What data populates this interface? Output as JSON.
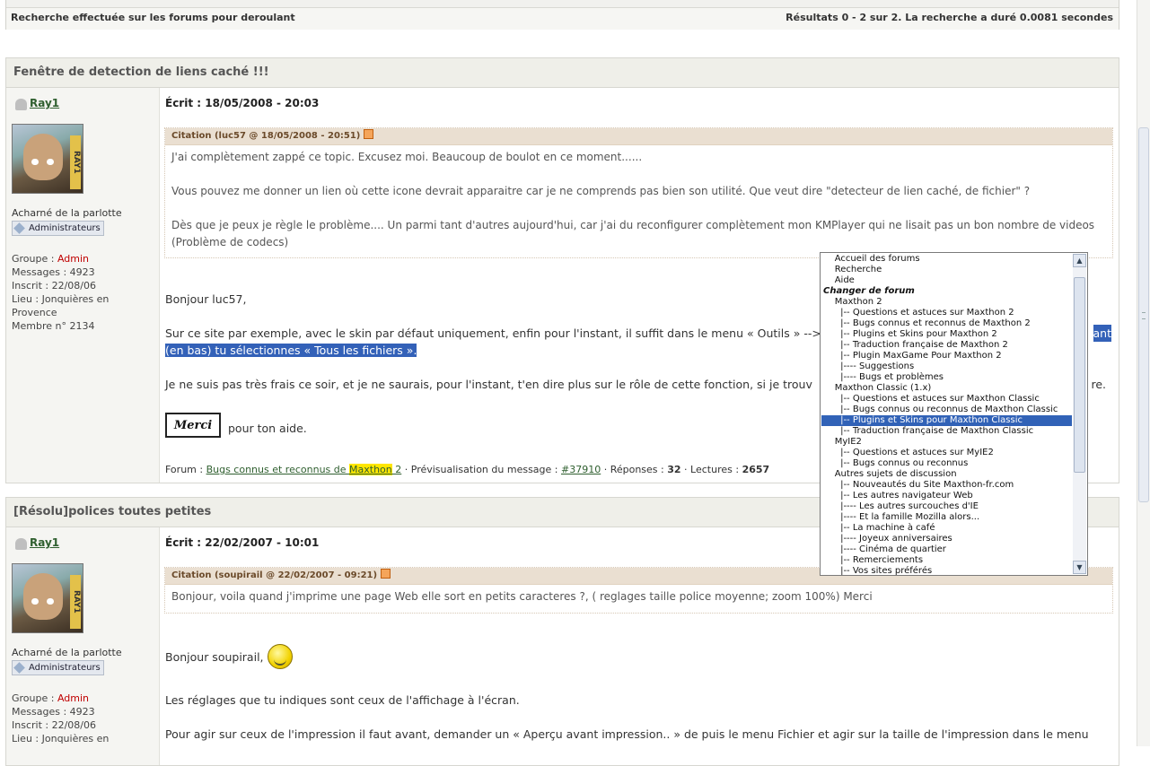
{
  "search_bar": {
    "left": "Recherche effectuée sur les forums pour deroulant",
    "right": "Résultats 0 - 2 sur 2. La recherche a duré 0.0081 secondes"
  },
  "posts": [
    {
      "title": "Fenêtre de detection de liens caché !!!",
      "user": "Ray1",
      "avatar_tag": "RAY1",
      "rank": "Acharné de la parlotte",
      "badge": "Administrateurs",
      "groupe_label": "Groupe : ",
      "groupe_value": "Admin",
      "messages": "Messages : 4923",
      "inscrit": "Inscrit : 22/08/06",
      "lieu": "Lieu : Jonquières en Provence",
      "membre": "Membre n° 2134",
      "written": "Écrit : 18/05/2008 - 20:03",
      "quote_head": "Citation (luc57 @ 18/05/2008 - 20:51)",
      "quote_lines": [
        "J'ai complètement zappé ce topic. Excusez moi. Beaucoup de boulot en ce moment......",
        "Vous pouvez me donner un lien où cette icone devrait apparaitre car je ne comprends pas bien son utilité. Que veut dire \"detecteur de lien caché, de fichier\" ?",
        "Dès que je peux je règle le problème.... Un parmi tant d'autres aujourd'hui, car j'ai du reconfigurer complètement mon KMPlayer qui ne lisait pas un bon nombre de videos (Problème de codecs)"
      ],
      "reply_greeting": "Bonjour luc57,",
      "reply_para1": "Sur ce site par exemple, avec le skin par défaut uniquement, enfin pour l'instant, il suffit dans le menu « Outils » -->",
      "reply_para1_hl_end": "ant",
      "reply_para1_hl_line2": "(en bas) tu sélectionnes « Tous les fichiers ».",
      "reply_para2": "Je ne suis pas très frais ce soir, et je ne saurais, pour l'instant, t'en dire plus sur le rôle de cette fonction, si je trouv",
      "reply_para2_end": "re.",
      "merci": "Merci",
      "thanks": "pour ton aide.",
      "forum_label": "Forum : ",
      "forum_link_pre": "Bugs connus et reconnus de ",
      "forum_link_hl": "Maxthon",
      "forum_link_post": " 2",
      "preview_label": " · Prévisualisation du message : ",
      "msg_id": "#37910",
      "replies_label": " · Réponses : ",
      "replies": "32",
      "reads_label": " · Lectures : ",
      "reads": "2657"
    },
    {
      "title": "[Résolu]polices toutes petites",
      "user": "Ray1",
      "avatar_tag": "RAY1",
      "rank": "Acharné de la parlotte",
      "badge": "Administrateurs",
      "groupe_label": "Groupe : ",
      "groupe_value": "Admin",
      "messages": "Messages : 4923",
      "inscrit": "Inscrit : 22/08/06",
      "lieu": "Lieu : Jonquières en",
      "written": "Écrit : 22/02/2007 - 10:01",
      "quote_head": "Citation (soupirail @ 22/02/2007 - 09:21)",
      "quote_lines": [
        "Bonjour, voila quand j'imprime une page Web elle sort en petits caracteres ?, ( reglages taille police moyenne; zoom 100%) Merci"
      ],
      "reply_greeting": "Bonjour soupirail,",
      "reply_para1": "Les réglages que tu indiques sont ceux de l'affichage à l'écran.",
      "reply_para2": "Pour agir sur ceux de l'impression il faut avant, demander un « Aperçu avant impression.. » de puis le menu Fichier et agir sur la taille de l'impression dans le menu"
    }
  ],
  "dropdown": {
    "options": [
      {
        "label": "    Accueil des forums",
        "type": "item"
      },
      {
        "label": "    Recherche",
        "type": "item"
      },
      {
        "label": "    Aide",
        "type": "item"
      },
      {
        "label": "Changer de forum",
        "type": "group"
      },
      {
        "label": "    Maxthon 2",
        "type": "item"
      },
      {
        "label": "      |-- Questions et astuces sur Maxthon 2",
        "type": "item"
      },
      {
        "label": "      |-- Bugs connus et reconnus de Maxthon 2",
        "type": "item"
      },
      {
        "label": "      |-- Plugins et Skins pour Maxthon 2",
        "type": "item"
      },
      {
        "label": "      |-- Traduction française de Maxthon 2",
        "type": "item"
      },
      {
        "label": "      |-- Plugin MaxGame Pour Maxthon 2",
        "type": "item"
      },
      {
        "label": "      |---- Suggestions",
        "type": "item"
      },
      {
        "label": "      |---- Bugs et problèmes",
        "type": "item"
      },
      {
        "label": "    Maxthon Classic (1.x)",
        "type": "item"
      },
      {
        "label": "      |-- Questions et astuces sur Maxthon Classic",
        "type": "item"
      },
      {
        "label": "      |-- Bugs connus ou reconnus de Maxthon Classic",
        "type": "item"
      },
      {
        "label": "      |-- Plugins et Skins pour Maxthon Classic",
        "type": "selected"
      },
      {
        "label": "      |-- Traduction française de Maxthon Classic",
        "type": "item"
      },
      {
        "label": "    MyIE2",
        "type": "item"
      },
      {
        "label": "      |-- Questions et astuces sur MyIE2",
        "type": "item"
      },
      {
        "label": "      |-- Bugs connus ou reconnus",
        "type": "item"
      },
      {
        "label": "    Autres sujets de discussion",
        "type": "item"
      },
      {
        "label": "      |-- Nouveautés du Site Maxthon-fr.com",
        "type": "item"
      },
      {
        "label": "      |-- Les autres navigateur Web",
        "type": "item"
      },
      {
        "label": "      |---- Les autres surcouches d'IE",
        "type": "item"
      },
      {
        "label": "      |---- Et la famille Mozilla alors...",
        "type": "item"
      },
      {
        "label": "      |-- La machine à café",
        "type": "item"
      },
      {
        "label": "      |---- Joyeux anniversaires",
        "type": "item"
      },
      {
        "label": "      |---- Cinéma de quartier",
        "type": "item"
      },
      {
        "label": "      |-- Remerciements",
        "type": "item"
      },
      {
        "label": "      |-- Vos sites préférés",
        "type": "item"
      }
    ]
  }
}
